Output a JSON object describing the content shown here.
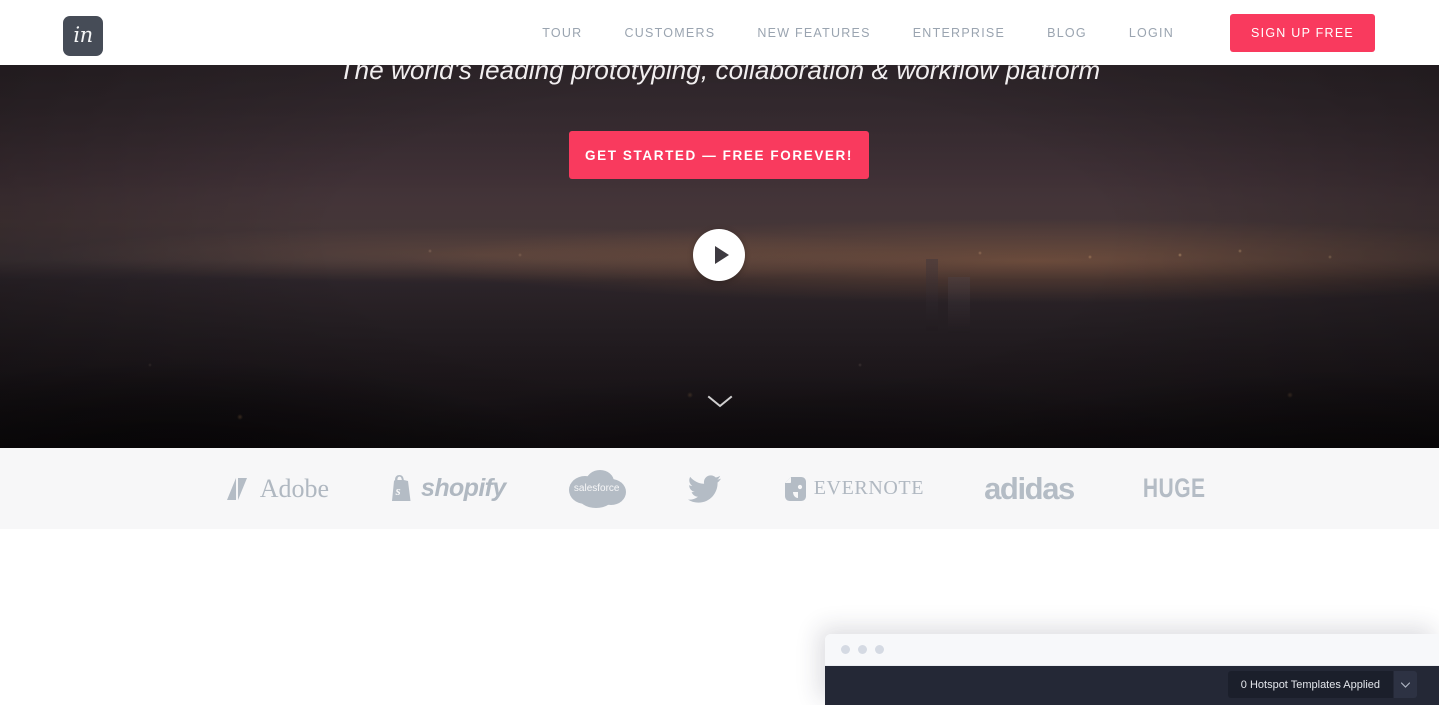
{
  "brand": {
    "logo_text": "in",
    "logo_icon": "invision-logo-icon",
    "accent_color": "#f93a5e",
    "nav_text_color": "#9aa4b0"
  },
  "nav": {
    "items": [
      {
        "label": "TOUR"
      },
      {
        "label": "CUSTOMERS"
      },
      {
        "label": "NEW FEATURES"
      },
      {
        "label": "ENTERPRISE"
      },
      {
        "label": "BLOG"
      },
      {
        "label": "LOGIN"
      }
    ],
    "signup_label": "SIGN UP FREE"
  },
  "hero": {
    "tagline": "The world's leading prototyping, collaboration & workflow platform",
    "cta_label": "GET STARTED — FREE FOREVER!",
    "play_icon": "play-icon",
    "scroll_icon": "chevron-down-icon",
    "background": "dusk-cityscape-photo"
  },
  "logo_strip": {
    "brands": [
      {
        "name": "Adobe",
        "wordmark": "Adobe",
        "icon": "adobe-a-icon"
      },
      {
        "name": "Shopify",
        "wordmark": "shopify",
        "icon": "shopify-bag-icon"
      },
      {
        "name": "Salesforce",
        "wordmark": "salesforce",
        "icon": "salesforce-cloud-icon"
      },
      {
        "name": "Twitter",
        "wordmark": "",
        "icon": "twitter-bird-icon"
      },
      {
        "name": "Evernote",
        "wordmark": "EVERNOTE",
        "icon": "evernote-elephant-icon"
      },
      {
        "name": "adidas",
        "wordmark": "adidas",
        "icon": ""
      },
      {
        "name": "HUGE",
        "wordmark": "HUGE",
        "icon": ""
      }
    ]
  },
  "browser_mock": {
    "titlebar_dots": 3,
    "hotspot_select": {
      "label": "0 Hotspot Templates Applied",
      "caret_icon": "caret-down-icon"
    }
  }
}
